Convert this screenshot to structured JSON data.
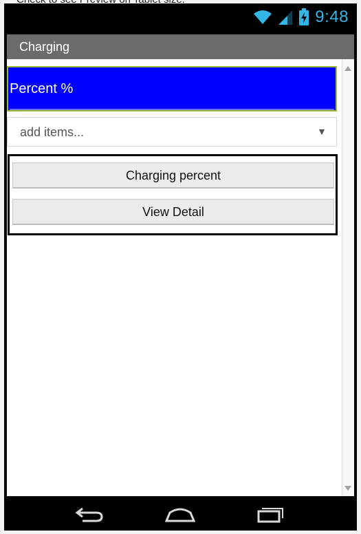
{
  "top_text": "Check to see Preview on Tablet size.",
  "status_bar": {
    "time": "9:48",
    "icons": [
      "wifi-icon",
      "signal-icon",
      "battery-charging-icon"
    ],
    "accent_color": "#33b5e5"
  },
  "app": {
    "title": "Charging"
  },
  "percent_box": {
    "label": "Percent %",
    "background": "#0000ff"
  },
  "spinner": {
    "placeholder": "add items...",
    "arrow": "▼"
  },
  "buttons": {
    "charging_percent": "Charging percent",
    "view_detail": "View Detail"
  },
  "nav_bar": {
    "icons": [
      "back-icon",
      "home-icon",
      "recents-icon"
    ]
  }
}
